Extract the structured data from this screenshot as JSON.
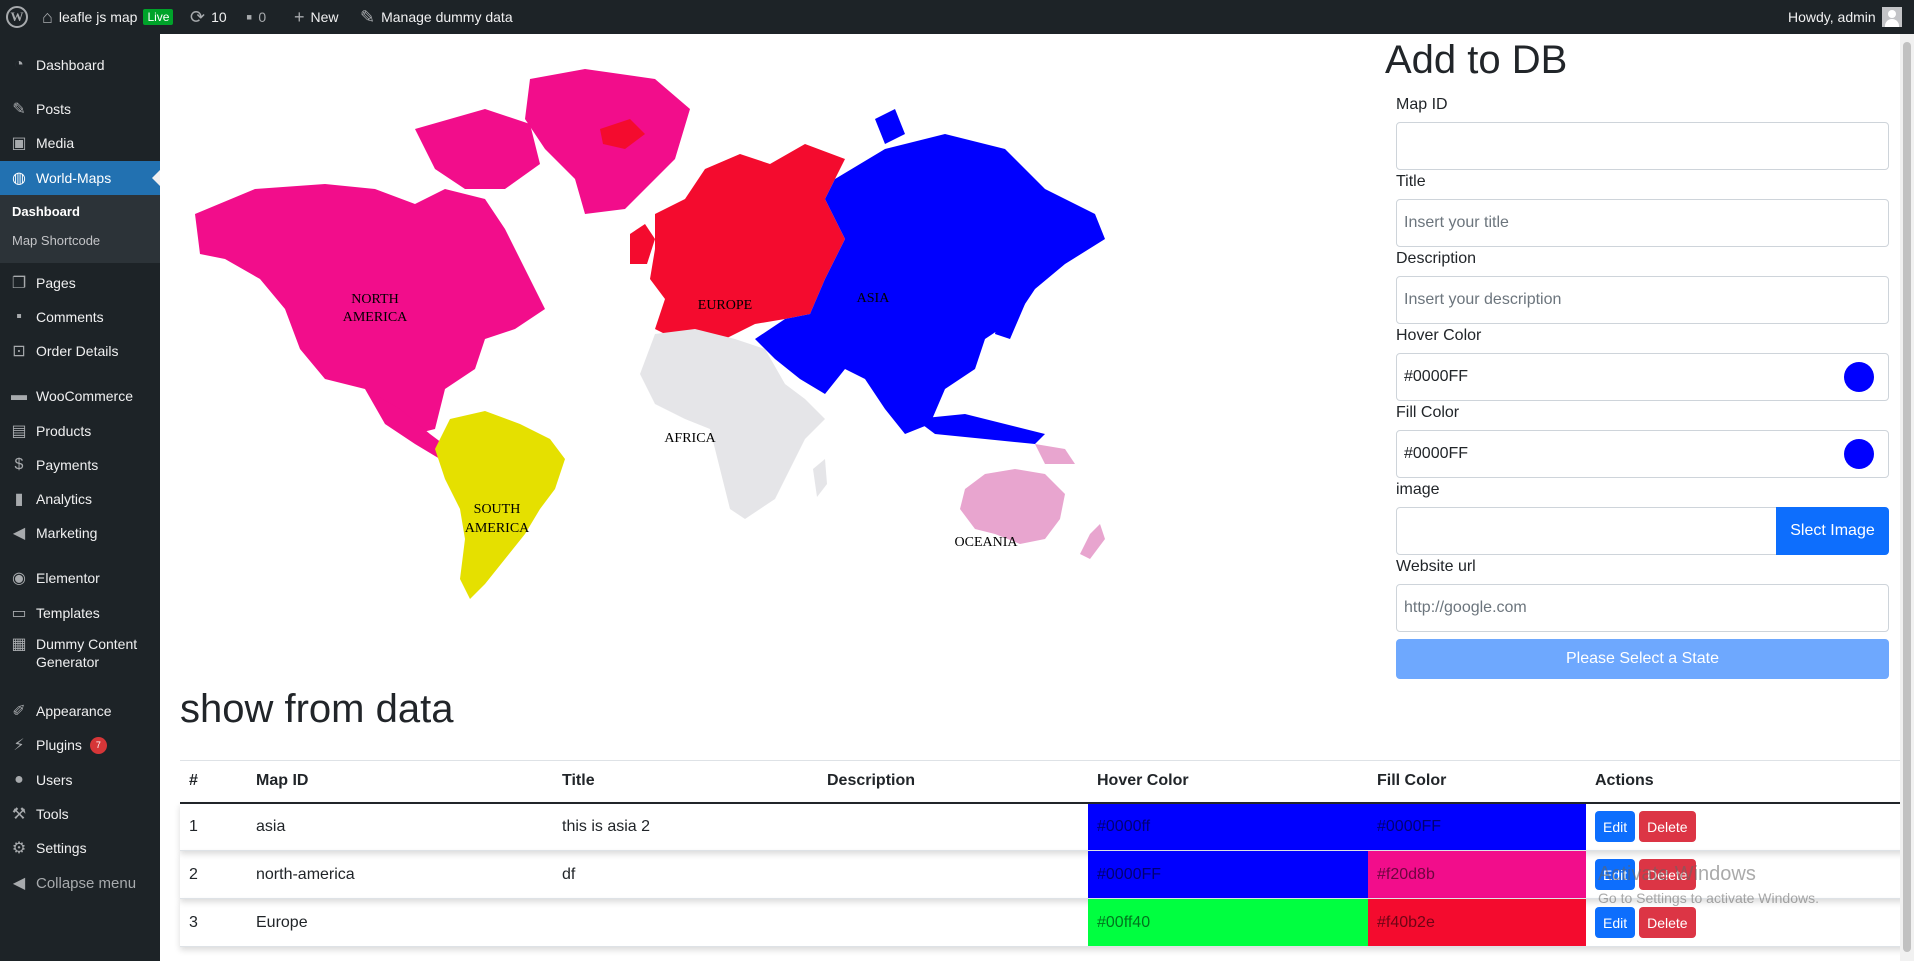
{
  "adminbar": {
    "site_name": "leafle js map",
    "live_badge": "Live",
    "updates_count": "10",
    "comments_count": "0",
    "new_label": "New",
    "manage_label": "Manage dummy data",
    "howdy": "Howdy, admin"
  },
  "sidebar": {
    "items": [
      {
        "label": "Dashboard",
        "icon": "dashboard-icon"
      },
      {
        "label": "Posts",
        "icon": "pin-icon"
      },
      {
        "label": "Media",
        "icon": "media-icon"
      },
      {
        "label": "World-Maps",
        "icon": "globe-icon"
      },
      {
        "label": "Pages",
        "icon": "pages-icon"
      },
      {
        "label": "Comments",
        "icon": "comment-icon"
      },
      {
        "label": "Order Details",
        "icon": "cart-icon"
      },
      {
        "label": "WooCommerce",
        "icon": "woo-icon"
      },
      {
        "label": "Products",
        "icon": "archive-icon"
      },
      {
        "label": "Payments",
        "icon": "dollar-icon"
      },
      {
        "label": "Analytics",
        "icon": "bar-chart-icon"
      },
      {
        "label": "Marketing",
        "icon": "megaphone-icon"
      },
      {
        "label": "Elementor",
        "icon": "elementor-icon"
      },
      {
        "label": "Templates",
        "icon": "folder-icon"
      },
      {
        "label": "Dummy Content",
        "label2": "Generator",
        "icon": "grid-icon"
      },
      {
        "label": "Appearance",
        "icon": "brush-icon"
      },
      {
        "label": "Plugins",
        "icon": "plugin-icon",
        "badge": "7"
      },
      {
        "label": "Users",
        "icon": "user-icon"
      },
      {
        "label": "Tools",
        "icon": "wrench-icon"
      },
      {
        "label": "Settings",
        "icon": "settings-icon"
      }
    ],
    "submenu": [
      "Dashboard",
      "Map Shortcode"
    ],
    "collapse": "Collapse menu"
  },
  "map": {
    "regions": [
      {
        "name": "NORTH",
        "name2": "AMERICA",
        "color": "#f20d8b"
      },
      {
        "name": "SOUTH",
        "name2": "AMERICA",
        "color": "#e5e000"
      },
      {
        "name": "EUROPE",
        "color": "#f40b2e"
      },
      {
        "name": "AFRICA",
        "color": "#e5e5e8"
      },
      {
        "name": "ASIA",
        "color": "#0000ff"
      },
      {
        "name": "OCEANIA",
        "color": "#e8a5cf"
      }
    ]
  },
  "form": {
    "title": "Add to DB",
    "map_id_label": "Map ID",
    "map_id_value": "",
    "title_label": "Title",
    "title_placeholder": "Insert your title",
    "description_label": "Description",
    "description_placeholder": "Insert your description",
    "hover_color_label": "Hover Color",
    "hover_color_value": "#0000FF",
    "fill_color_label": "Fill Color",
    "fill_color_value": "#0000FF",
    "image_label": "image",
    "select_image": "Slect Image",
    "website_label": "Website url",
    "website_placeholder": "http://google.com",
    "submit": "Please Select a State"
  },
  "table": {
    "title": "show from data",
    "headers": [
      "#",
      "Map ID",
      "Title",
      "Description",
      "Hover Color",
      "Fill Color",
      "Actions"
    ],
    "rows": [
      {
        "num": "1",
        "map_id": "asia",
        "title": "this is asia 2",
        "description": "",
        "hover": "#0000ff",
        "hover_bg": "#0000ff",
        "fill": "#0000FF",
        "fill_bg": "#0000ff"
      },
      {
        "num": "2",
        "map_id": "north-america",
        "title": "df",
        "description": "",
        "hover": "#0000FF",
        "hover_bg": "#0000ff",
        "fill": "#f20d8b",
        "fill_bg": "#f20d8b"
      },
      {
        "num": "3",
        "map_id": "Europe",
        "title": "",
        "description": "",
        "hover": "#00ff40",
        "hover_bg": "#00ff40",
        "fill": "#f40b2e",
        "fill_bg": "#f40b2e"
      }
    ],
    "edit": "Edit",
    "delete": "Delete"
  },
  "watermark": {
    "line1": "Activate Windows",
    "line2": "Go to Settings to activate Windows."
  }
}
